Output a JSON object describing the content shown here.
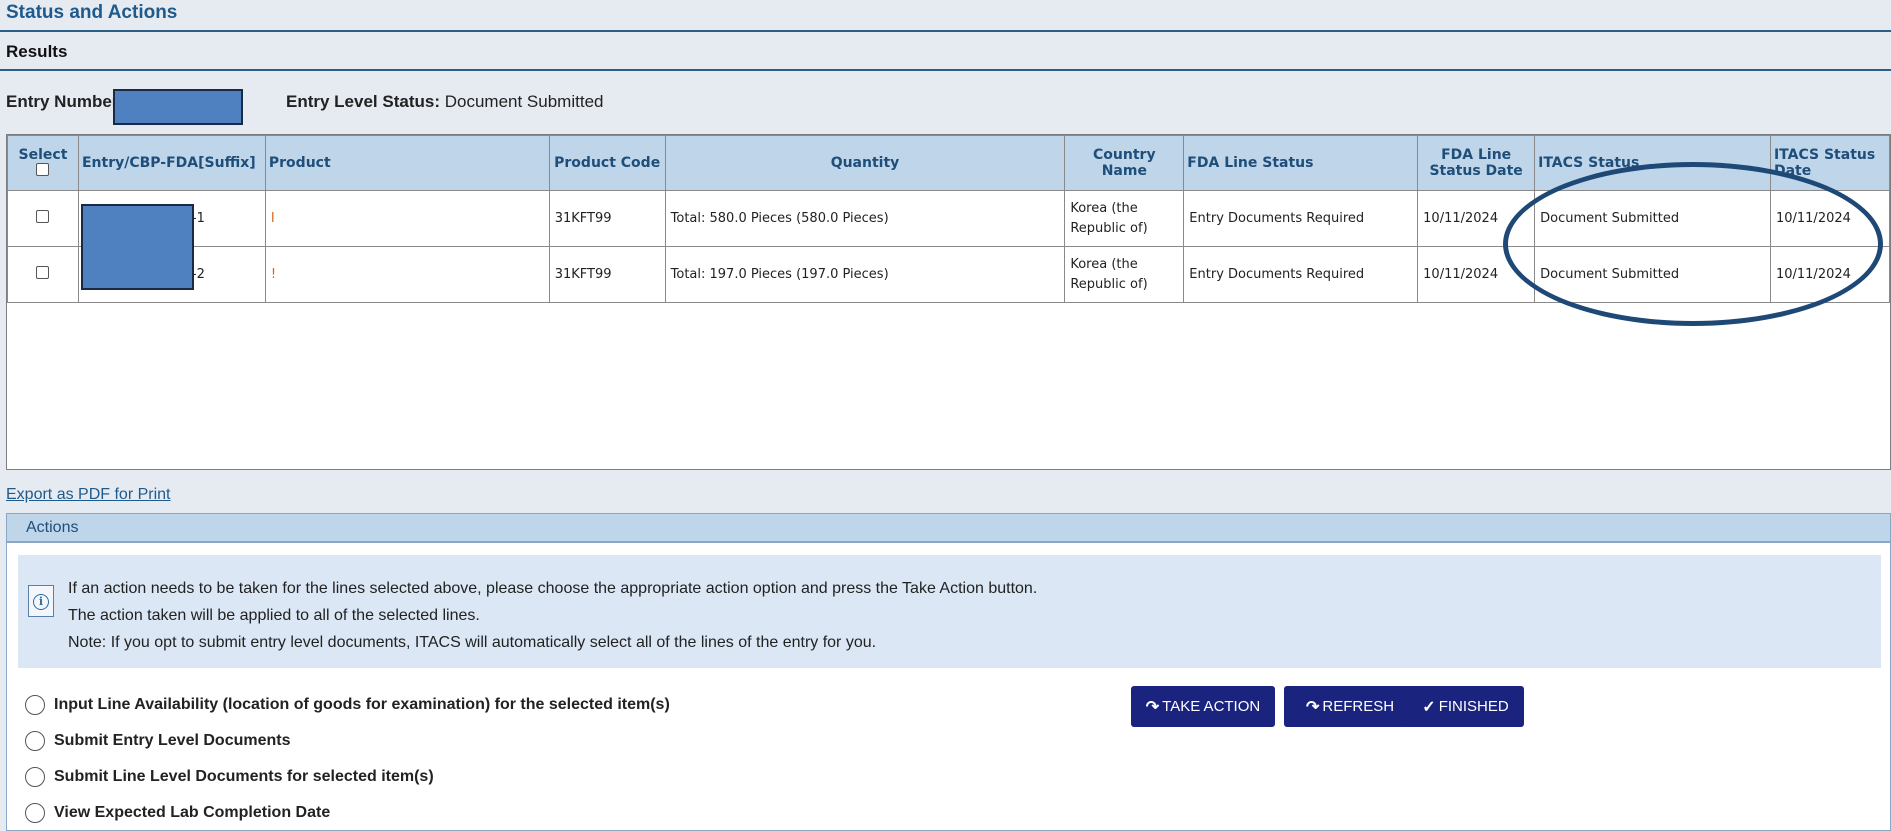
{
  "header": {
    "title": "Status and Actions",
    "results": "Results"
  },
  "entry": {
    "number_label": "Entry Number",
    "status_label": "Entry Level Status:",
    "status_value": "Document Submitted"
  },
  "table": {
    "columns": [
      "Select",
      "Entry/CBP-FDA[Suffix]",
      "Product",
      "Product Code",
      "Quantity",
      "Country Name",
      "FDA Line Status",
      "FDA Line Status Date",
      "ITACS Status",
      "ITACS Status Date"
    ],
    "rows": [
      {
        "suffix": "-1",
        "product": "I",
        "product_code": "31KFT99",
        "quantity": "Total: 580.0 Pieces (580.0 Pieces)",
        "country": "Korea (the Republic of)",
        "fda_status": "Entry Documents Required",
        "fda_date": "10/11/2024",
        "itacs_status": "Document Submitted",
        "itacs_date": "10/11/2024"
      },
      {
        "suffix": "-2",
        "product": "!",
        "product_code": "31KFT99",
        "quantity": "Total: 197.0 Pieces (197.0 Pieces)",
        "country": "Korea (the Republic of)",
        "fda_status": "Entry Documents Required",
        "fda_date": "10/11/2024",
        "itacs_status": "Document Submitted",
        "itacs_date": "10/11/2024"
      }
    ]
  },
  "export_link": "Export as PDF for Print",
  "actions": {
    "header": "Actions",
    "info_lines": [
      "If an action needs to be taken for the lines selected above, please choose the appropriate action option and press the Take Action button.",
      "The action taken will be applied to all of the selected lines.",
      "Note: If you opt to submit entry level documents, ITACS will automatically select all of the lines of the entry for you."
    ],
    "options": [
      "Input Line Availability (location of goods for examination) for the selected item(s)",
      "Submit Entry Level Documents",
      "Submit Line Level Documents for selected item(s)",
      "View Expected Lab Completion Date"
    ],
    "buttons": {
      "take_action": "TAKE ACTION",
      "refresh": "REFRESH",
      "finished": "FINISHED"
    }
  },
  "icons": {
    "info": "info-icon",
    "take_action": "redo-arrow-icon",
    "refresh": "redo-arrow-icon",
    "finished": "checkmark-icon"
  },
  "colors": {
    "header_blue": "#bfd5ea",
    "button_navy": "#1a237e",
    "title_blue": "#1f5a8c",
    "redaction": "#4f81c0",
    "highlight_oval": "#1e4876"
  }
}
